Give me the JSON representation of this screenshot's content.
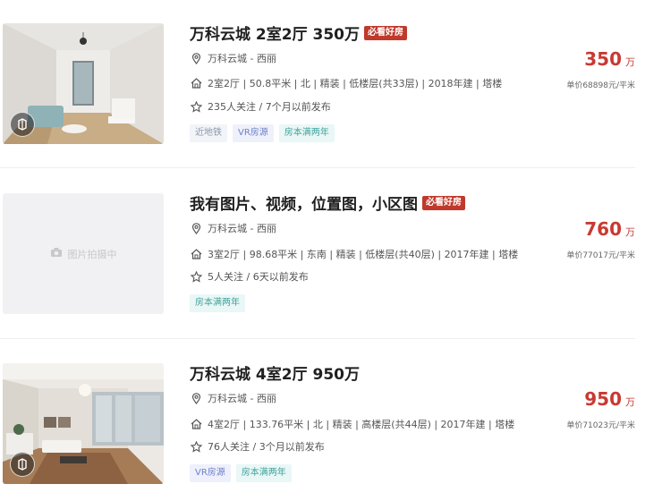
{
  "listings": [
    {
      "title": "万科云城 2室2厅 350万",
      "badge": "必看好房",
      "location": "万科云城 - 西丽",
      "details": "2室2厅 | 50.8平米 | 北 | 精装 | 低楼层(共33层) | 2018年建 | 塔楼",
      "followers": "235人关注 / 7个月以前发布",
      "tags": [
        "近地铁",
        "VR房源",
        "房本满两年"
      ],
      "price": "350",
      "price_unit": "万",
      "unit_price": "单价68898元/平米"
    },
    {
      "title": "我有图片、视频，位置图，小区图",
      "badge": "必看好房",
      "location": "万科云城 - 西丽",
      "details": "3室2厅 | 98.68平米 | 东南 | 精装 | 低楼层(共40层) | 2017年建 | 塔楼",
      "followers": "5人关注 / 6天以前发布",
      "tags": [
        "房本满两年"
      ],
      "price": "760",
      "price_unit": "万",
      "unit_price": "单价77017元/平米",
      "photo_placeholder": "图片拍摄中"
    },
    {
      "title": "万科云城 4室2厅 950万",
      "location": "万科云城 - 西丽",
      "details": "4室2厅 | 133.76平米 | 北 | 精装 | 高楼层(共44层) | 2017年建 | 塔楼",
      "followers": "76人关注 / 3个月以前发布",
      "tags": [
        "VR房源",
        "房本满两年"
      ],
      "price": "950",
      "price_unit": "万",
      "unit_price": "单价71023元/平米"
    }
  ],
  "icons": {
    "location": "map-pin-icon",
    "layout": "house-icon",
    "followers": "star-icon",
    "vr": "vr-badge-icon",
    "camera": "camera-icon"
  },
  "colors": {
    "price": "#c83a32",
    "badge": "#c0392b"
  }
}
